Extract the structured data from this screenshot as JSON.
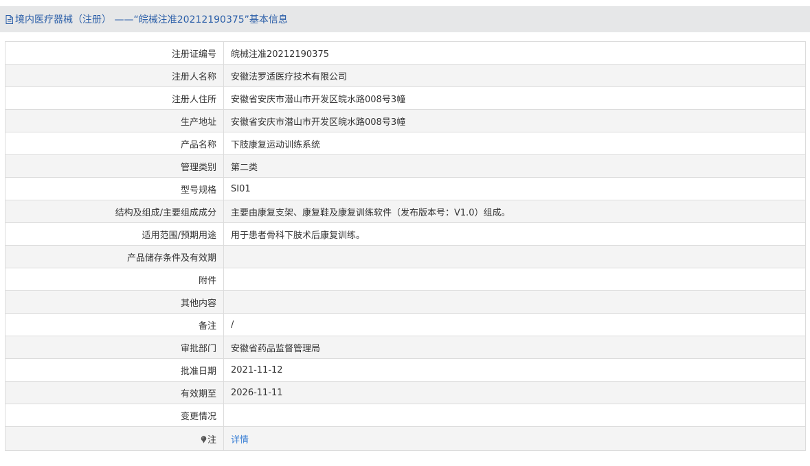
{
  "header": {
    "icon": "document-icon",
    "title": "境内医疗器械（注册） ——“皖械注准20212190375”基本信息",
    "color": "#2a5ea8"
  },
  "rows": [
    {
      "label": "注册证编号",
      "value": "皖械注准20212190375"
    },
    {
      "label": "注册人名称",
      "value": "安徽法罗适医疗技术有限公司"
    },
    {
      "label": "注册人住所",
      "value": "安徽省安庆市潜山市开发区皖水路008号3幢"
    },
    {
      "label": "生产地址",
      "value": "安徽省安庆市潜山市开发区皖水路008号3幢"
    },
    {
      "label": "产品名称",
      "value": "下肢康复运动训练系统"
    },
    {
      "label": "管理类别",
      "value": "第二类"
    },
    {
      "label": "型号规格",
      "value": "SI01"
    },
    {
      "label": "结构及组成/主要组成成分",
      "value": "主要由康复支架、康复鞋及康复训练软件（发布版本号：V1.0）组成。"
    },
    {
      "label": "适用范围/预期用途",
      "value": "用于患者骨科下肢术后康复训练。"
    },
    {
      "label": "产品储存条件及有效期",
      "value": ""
    },
    {
      "label": "附件",
      "value": ""
    },
    {
      "label": "其他内容",
      "value": ""
    },
    {
      "label": "备注",
      "value": "/"
    },
    {
      "label": "审批部门",
      "value": "安徽省药品监督管理局"
    },
    {
      "label": "批准日期",
      "value": "2021-11-12"
    },
    {
      "label": "有效期至",
      "value": "2026-11-11"
    },
    {
      "label": "变更情况",
      "value": ""
    }
  ],
  "note_row": {
    "icon": "pin-icon",
    "label": "注",
    "link_text": "详情",
    "link_color": "#3a7fd5"
  }
}
